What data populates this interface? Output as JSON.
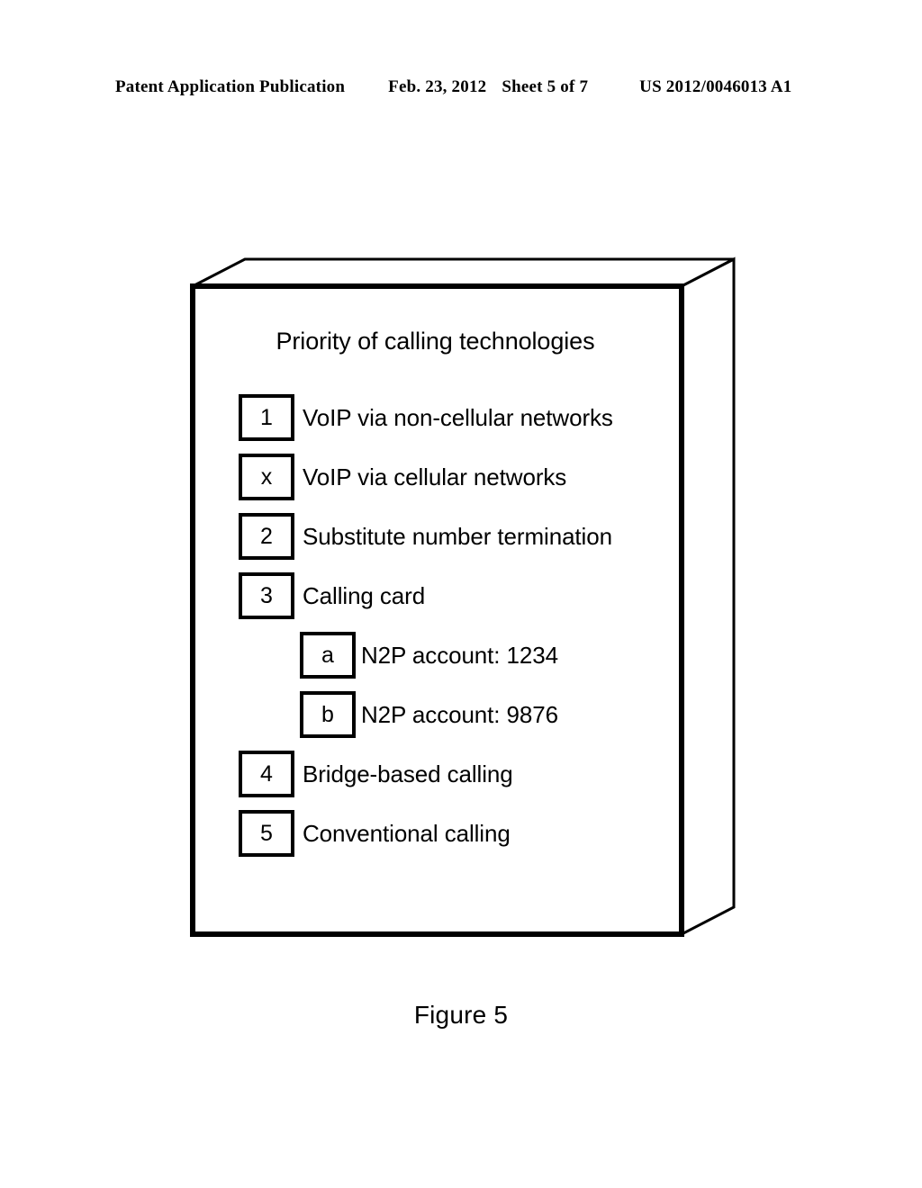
{
  "header": {
    "publication": "Patent Application Publication",
    "date": "Feb. 23, 2012",
    "sheet": "Sheet 5 of 7",
    "document_number": "US 2012/0046013 A1"
  },
  "figure": {
    "caption": "Figure 5",
    "box": {
      "title": "Priority of calling technologies",
      "rows": [
        {
          "marker": "1",
          "label": "VoIP via non-cellular networks",
          "level": 0
        },
        {
          "marker": "x",
          "label": "VoIP via cellular networks",
          "level": 0
        },
        {
          "marker": "2",
          "label": "Substitute number termination",
          "level": 0
        },
        {
          "marker": "3",
          "label": "Calling card",
          "level": 0
        },
        {
          "marker": "a",
          "label": "N2P account: 1234",
          "level": 1
        },
        {
          "marker": "b",
          "label": "N2P account: 9876",
          "level": 1
        },
        {
          "marker": "4",
          "label": "Bridge-based calling",
          "level": 0
        },
        {
          "marker": "5",
          "label": "Conventional calling",
          "level": 0
        }
      ]
    }
  },
  "style": {
    "ink": "#000000",
    "paper": "#ffffff"
  }
}
